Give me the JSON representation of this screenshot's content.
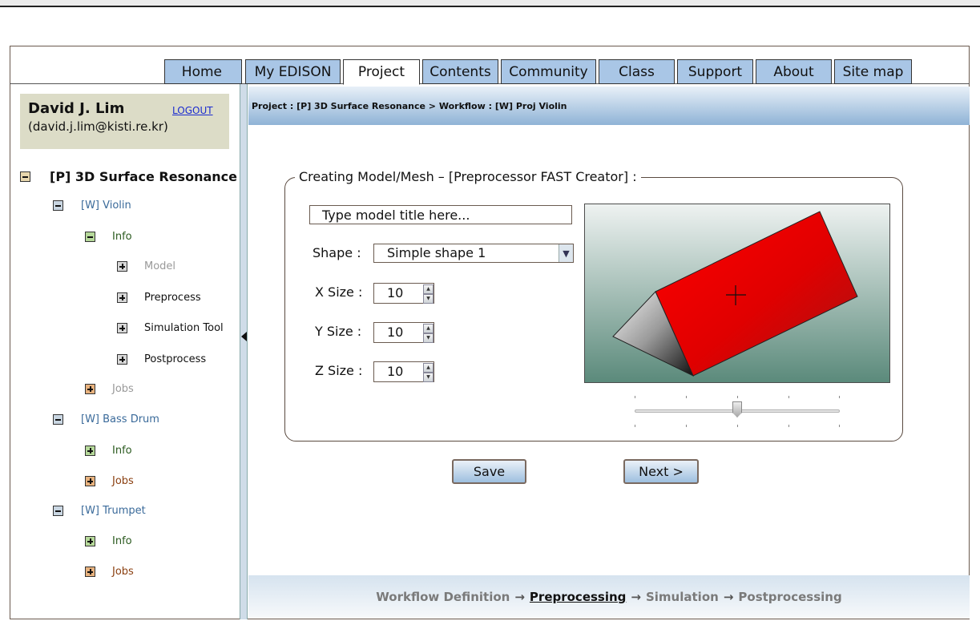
{
  "nav": {
    "tabs": [
      {
        "label": "Home",
        "active": false
      },
      {
        "label": "My EDISON",
        "active": false
      },
      {
        "label": "Project",
        "active": true
      },
      {
        "label": "Contents",
        "active": false
      },
      {
        "label": "Community",
        "active": false
      },
      {
        "label": "Class",
        "active": false
      },
      {
        "label": "Support",
        "active": false
      },
      {
        "label": "About",
        "active": false
      },
      {
        "label": "Site map",
        "active": false
      }
    ]
  },
  "user": {
    "name": "David J. Lim",
    "email": "(david.j.lim@kisti.re.kr)",
    "logout_label": "LOGOUT"
  },
  "tree": {
    "root": {
      "label": "[P] 3D Surface Resonance",
      "icon": "minus-icon"
    },
    "items": [
      {
        "label": "[W] Violin",
        "icon": "minus-icon",
        "color": "#3a6a9a"
      },
      {
        "label": "Info",
        "icon": "minus-icon",
        "color": "#2b5a1f"
      },
      {
        "label": "Model",
        "icon": "plus-icon",
        "color": "#999999"
      },
      {
        "label": "Preprocess",
        "icon": "plus-icon",
        "color": "#111111"
      },
      {
        "label": "Simulation Tool",
        "icon": "plus-icon",
        "color": "#111111"
      },
      {
        "label": "Postprocess",
        "icon": "plus-icon",
        "color": "#111111"
      },
      {
        "label": "Jobs",
        "icon": "plus-icon",
        "color": "#999999"
      },
      {
        "label": "[W] Bass Drum",
        "icon": "minus-icon",
        "color": "#3a6a9a"
      },
      {
        "label": "Info",
        "icon": "plus-icon",
        "color": "#2b5a1f"
      },
      {
        "label": "Jobs",
        "icon": "plus-icon",
        "color": "#8a3f10"
      },
      {
        "label": "[W] Trumpet",
        "icon": "minus-icon",
        "color": "#3a6a9a"
      },
      {
        "label": "Info",
        "icon": "plus-icon",
        "color": "#2b5a1f"
      },
      {
        "label": "Jobs",
        "icon": "plus-icon",
        "color": "#8a3f10"
      }
    ]
  },
  "breadcrumb": "Project : [P] 3D Surface Resonance > Workflow : [W] Proj Violin",
  "form": {
    "legend": "Creating Model/Mesh – [Preprocessor FAST Creator] :",
    "title_placeholder": "Type model title here...",
    "shape_label": "Shape :",
    "shape_value": "Simple shape 1",
    "x_label": "X Size :",
    "x_value": "10",
    "y_label": "Y Size :",
    "y_value": "10",
    "z_label": "Z Size :",
    "z_value": "10",
    "zoom_level": 0.5
  },
  "buttons": {
    "save_label": "Save",
    "next_label": "Next >"
  },
  "steps": [
    {
      "label": "Workflow Definition",
      "current": false
    },
    {
      "label": "Preprocessing",
      "current": true
    },
    {
      "label": "Simulation",
      "current": false
    },
    {
      "label": "Postprocessing",
      "current": false
    }
  ],
  "step_arrow": "→"
}
